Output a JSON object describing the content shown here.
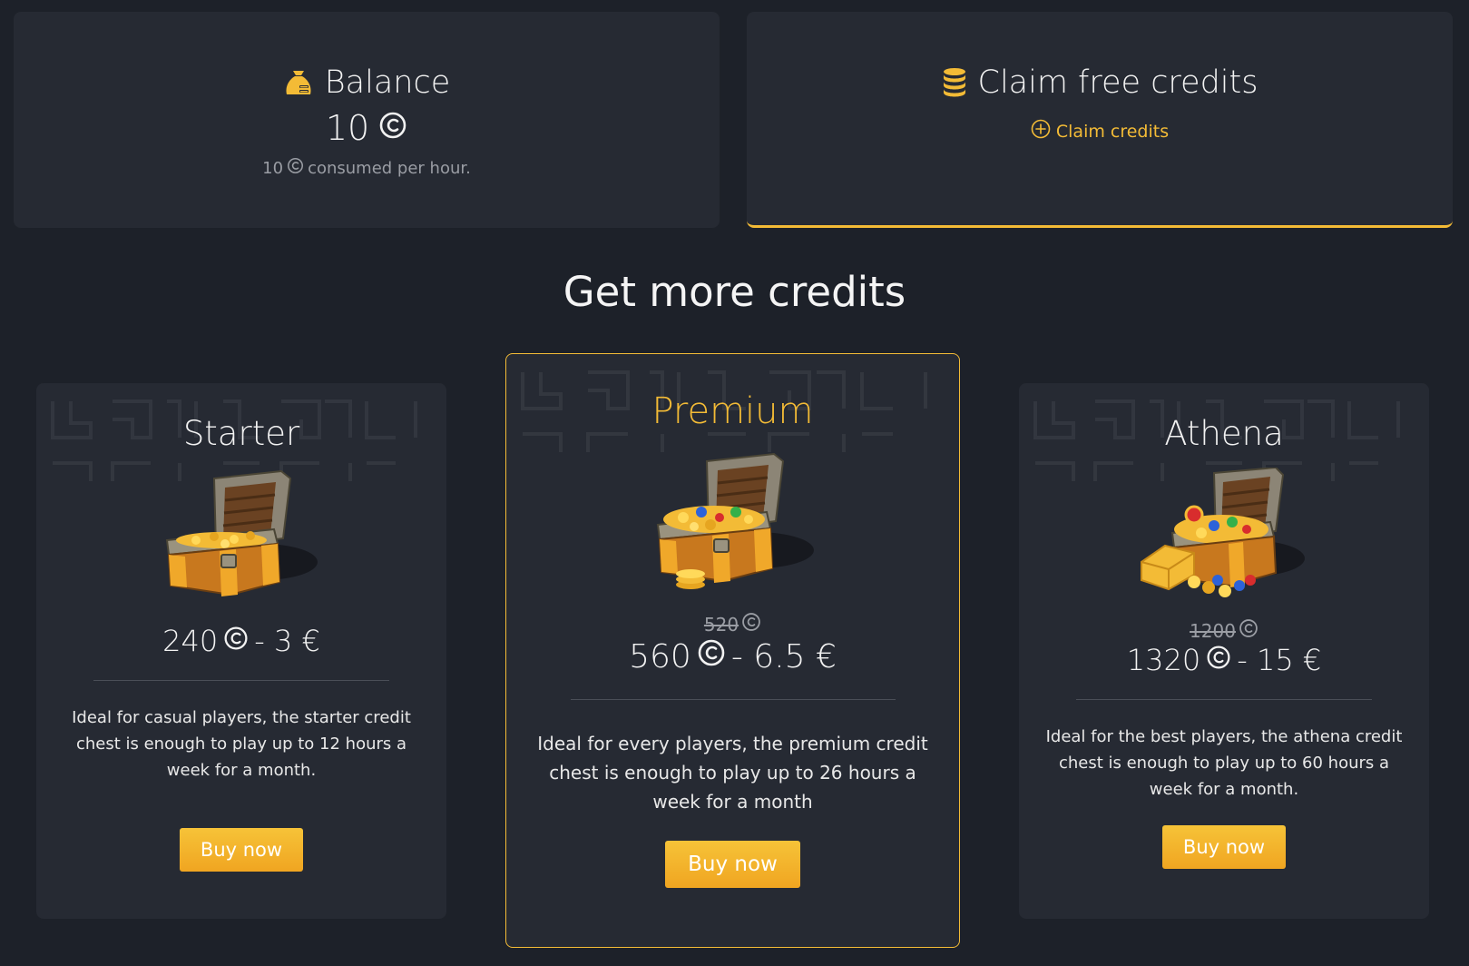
{
  "balance": {
    "title": "Balance",
    "amount": "10",
    "consumed_amount": "10",
    "consumed_text": "consumed per hour."
  },
  "claim": {
    "title": "Claim free credits",
    "button_label": "Claim credits"
  },
  "section": {
    "title": "Get more credits"
  },
  "plans": [
    {
      "name": "Starter",
      "old_credits": "",
      "credits": "240",
      "price": "- 3 €",
      "description": "Ideal for casual players, the starter credit chest is enough to play up to 12 hours a week for a month.",
      "button_label": "Buy now"
    },
    {
      "name": "Premium",
      "old_credits": "520",
      "credits": "560",
      "price": "- 6.5 €",
      "description": "Ideal for every players, the premium credit chest is enough to play up to 26 hours a week for a month",
      "button_label": "Buy now"
    },
    {
      "name": "Athena",
      "old_credits": "1200",
      "credits": "1320",
      "price": "- 15 €",
      "description": "Ideal for the best players, the athena credit chest is enough to play up to 60 hours a week for a month.",
      "button_label": "Buy now"
    }
  ],
  "icons": {
    "balance": "money-bag-icon",
    "claim": "coin-stack-icon",
    "claim_button": "plus-circle-icon",
    "credit": "credit-coin-icon"
  },
  "colors": {
    "accent": "#f3bb36",
    "background": "#1d2129",
    "card": "#262a33"
  }
}
